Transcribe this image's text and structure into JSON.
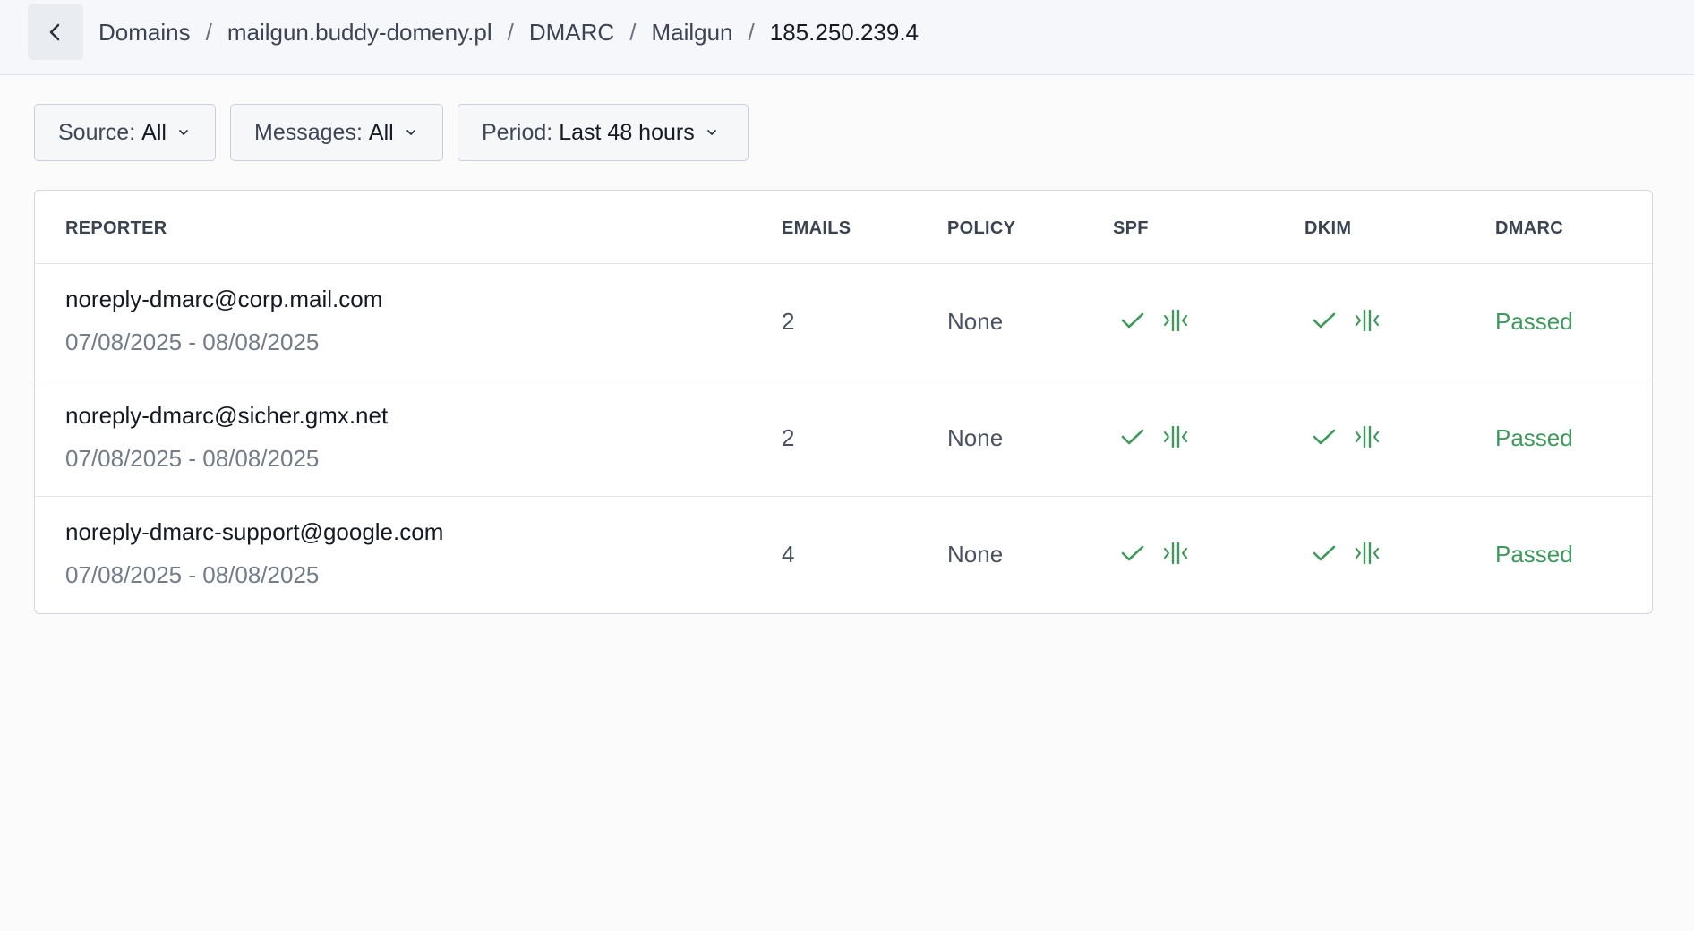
{
  "breadcrumb": {
    "items": [
      "Domains",
      "mailgun.buddy-domeny.pl",
      "DMARC",
      "Mailgun"
    ],
    "current": "185.250.239.4",
    "separator": "/"
  },
  "filters": {
    "source": {
      "label": "Source:",
      "value": "All"
    },
    "messages": {
      "label": "Messages:",
      "value": "All"
    },
    "period": {
      "label": "Period:",
      "value": "Last 48 hours"
    }
  },
  "table": {
    "headers": {
      "reporter": "REPORTER",
      "emails": "EMAILS",
      "policy": "POLICY",
      "spf": "SPF",
      "dkim": "DKIM",
      "dmarc": "DMARC"
    },
    "rows": [
      {
        "reporter": "noreply-dmarc@corp.mail.com",
        "period": "07/08/2025 - 08/08/2025",
        "emails": "2",
        "policy": "None",
        "spf": {
          "result": "pass-icon",
          "alignment": "aligned-icon"
        },
        "dkim": {
          "result": "pass-icon",
          "alignment": "aligned-icon"
        },
        "dmarc": "Passed"
      },
      {
        "reporter": "noreply-dmarc@sicher.gmx.net",
        "period": "07/08/2025 - 08/08/2025",
        "emails": "2",
        "policy": "None",
        "spf": {
          "result": "pass-icon",
          "alignment": "aligned-icon"
        },
        "dkim": {
          "result": "pass-icon",
          "alignment": "aligned-icon"
        },
        "dmarc": "Passed"
      },
      {
        "reporter": "noreply-dmarc-support@google.com",
        "period": "07/08/2025 - 08/08/2025",
        "emails": "4",
        "policy": "None",
        "spf": {
          "result": "pass-icon",
          "alignment": "aligned-icon"
        },
        "dkim": {
          "result": "pass-icon",
          "alignment": "aligned-icon"
        },
        "dmarc": "Passed"
      }
    ]
  },
  "colors": {
    "pass": "#3e9a5c",
    "text": "#141a24",
    "muted": "#737c89",
    "topbar": "#f5f7fb"
  }
}
